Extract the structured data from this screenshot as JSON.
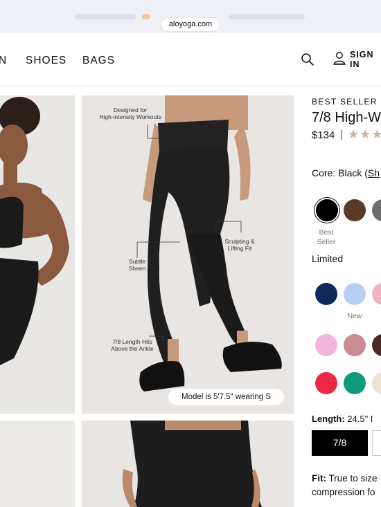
{
  "browser": {
    "url": "aloyoga.com"
  },
  "nav": {
    "items": [
      "N",
      "SHOES",
      "BAGS"
    ],
    "sign_in": "SIGN IN"
  },
  "gallery": {
    "callouts": {
      "workouts": "Designed for\nHigh-intensity Workouts",
      "sculpt": "Sculpting &\nLifting Fit",
      "sheen": "Subtle\nSheen",
      "length": "7/8 Length Hits\nAbove the Ankle"
    },
    "model_note": "Model is 5'7.5\" wearing S"
  },
  "product": {
    "badge": "BEST SELLER",
    "title": "7/8 High-W",
    "price": "$134",
    "price_sep": "|",
    "rating_stars": 5,
    "color_prefix": "Core: Black (",
    "color_link": "Sh",
    "core_swatches": [
      {
        "name": "Black",
        "color": "#000000",
        "selected": true,
        "label": "Best\nSeller"
      },
      {
        "name": "Espresso",
        "color": "#5a3a27",
        "selected": false,
        "label": ""
      },
      {
        "name": "Gray",
        "color": "#6e6e6e",
        "selected": false,
        "label": ""
      }
    ],
    "limited_label": "Limited",
    "limited_swatches": [
      {
        "color": "#102a5c",
        "label": ""
      },
      {
        "color": "#b8d0f4",
        "label": "New"
      },
      {
        "color": "#efb6c2",
        "label": ""
      },
      {
        "color": "#f3b6e0",
        "label": ""
      },
      {
        "color": "#c98b94",
        "label": ""
      },
      {
        "color": "#4a2a24",
        "label": ""
      },
      {
        "color": "#ec2944",
        "label": ""
      },
      {
        "color": "#0f9a7c",
        "label": ""
      },
      {
        "color": "#efe2cf",
        "label": ""
      }
    ],
    "length_label": "Length:",
    "length_value": "24.5\" I",
    "length_option": "7/8",
    "fit_label": "Fit:",
    "fit_value": "True to size",
    "fit_line2": "compression fo"
  }
}
